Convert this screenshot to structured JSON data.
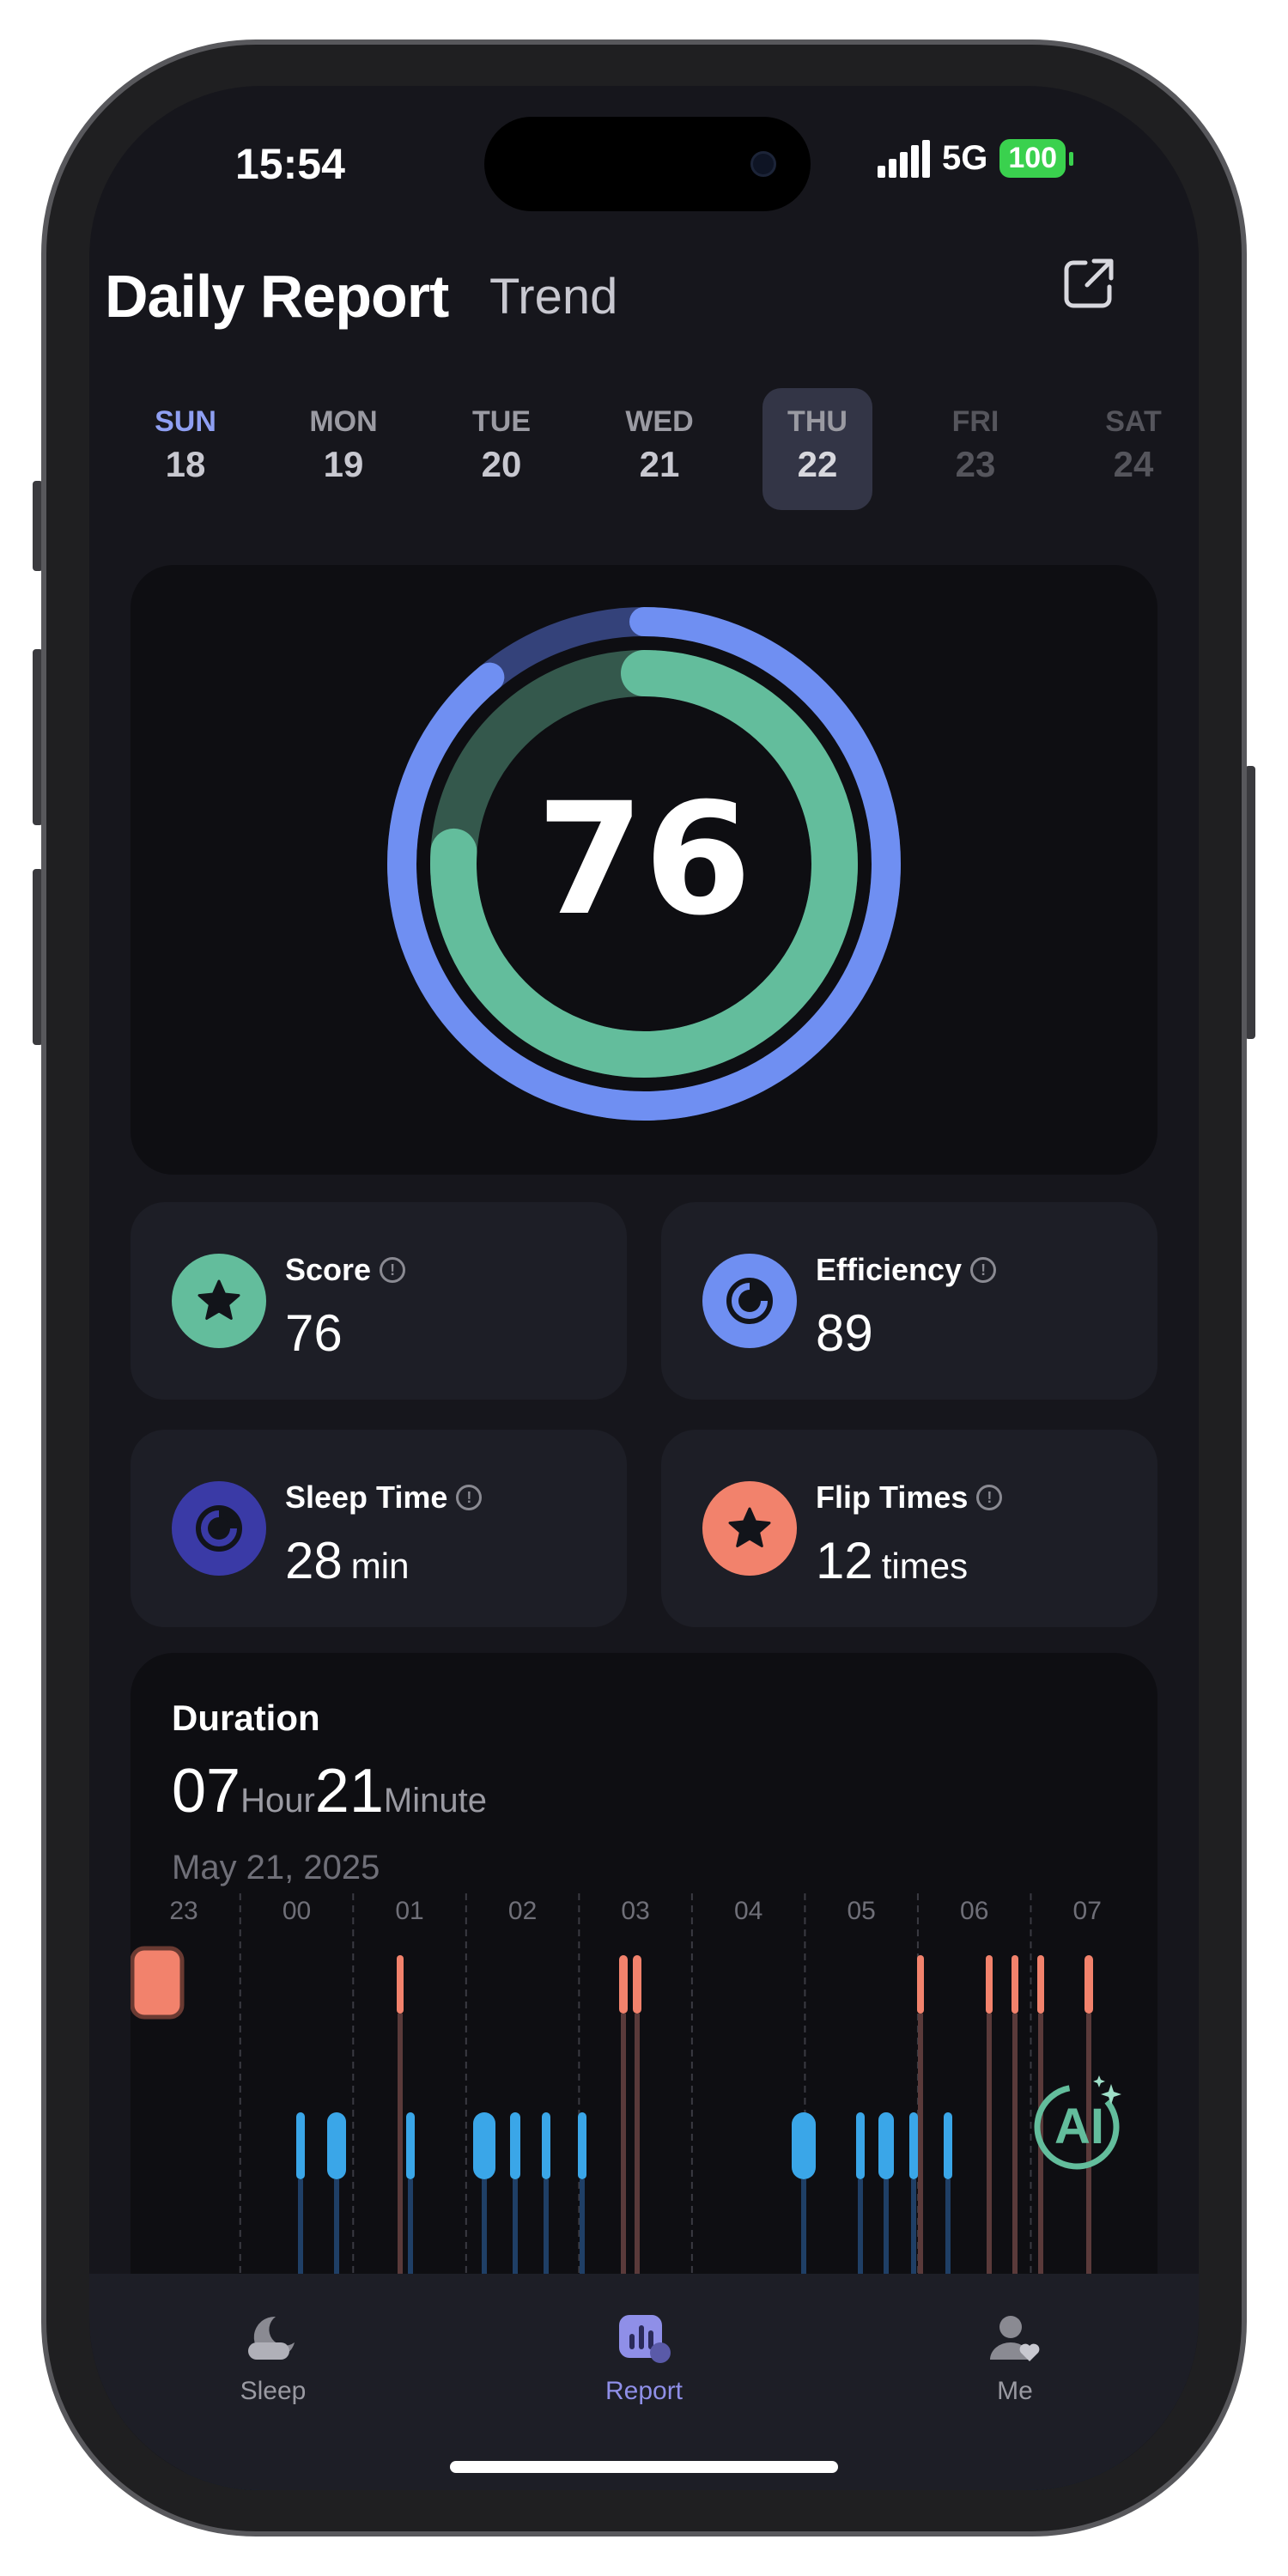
{
  "status": {
    "time": "15:54",
    "network": "5G",
    "battery": "100"
  },
  "header": {
    "title": "Daily Report",
    "tab_trend": "Trend"
  },
  "days": [
    {
      "name": "SUN",
      "date": "18",
      "state": "accent"
    },
    {
      "name": "MON",
      "date": "19",
      "state": "normal"
    },
    {
      "name": "TUE",
      "date": "20",
      "state": "normal"
    },
    {
      "name": "WED",
      "date": "21",
      "state": "normal"
    },
    {
      "name": "THU",
      "date": "22",
      "state": "selected"
    },
    {
      "name": "FRI",
      "date": "23",
      "state": "dim"
    },
    {
      "name": "SAT",
      "date": "24",
      "state": "dim"
    }
  ],
  "score_ring": {
    "value": "76",
    "outer_level": 0.89,
    "inner_level": 0.76
  },
  "stats": {
    "score": {
      "label": "Score",
      "value": "76",
      "unit": ""
    },
    "efficiency": {
      "label": "Efficiency",
      "value": "89",
      "unit": ""
    },
    "sleep_time": {
      "label": "Sleep Time",
      "value": "28",
      "unit": "min"
    },
    "flip_times": {
      "label": "Flip Times",
      "value": "12",
      "unit": "times"
    }
  },
  "duration": {
    "title": "Duration",
    "hours": "07",
    "hours_unit": "Hour",
    "minutes": "21",
    "minutes_unit": "Minute",
    "date": "May 21, 2025",
    "hour_ticks": [
      "23",
      "00",
      "01",
      "02",
      "03",
      "04",
      "05",
      "06",
      "07"
    ],
    "ai_label": "AI"
  },
  "tabs": {
    "sleep": "Sleep",
    "report": "Report",
    "me": "Me"
  },
  "colors": {
    "accent_blue": "#6f8ff2",
    "accent_green": "#63bd9c",
    "indigo": "#3a3aa6",
    "coral": "#f2826c",
    "selected_tab": "#8f8fe8"
  }
}
